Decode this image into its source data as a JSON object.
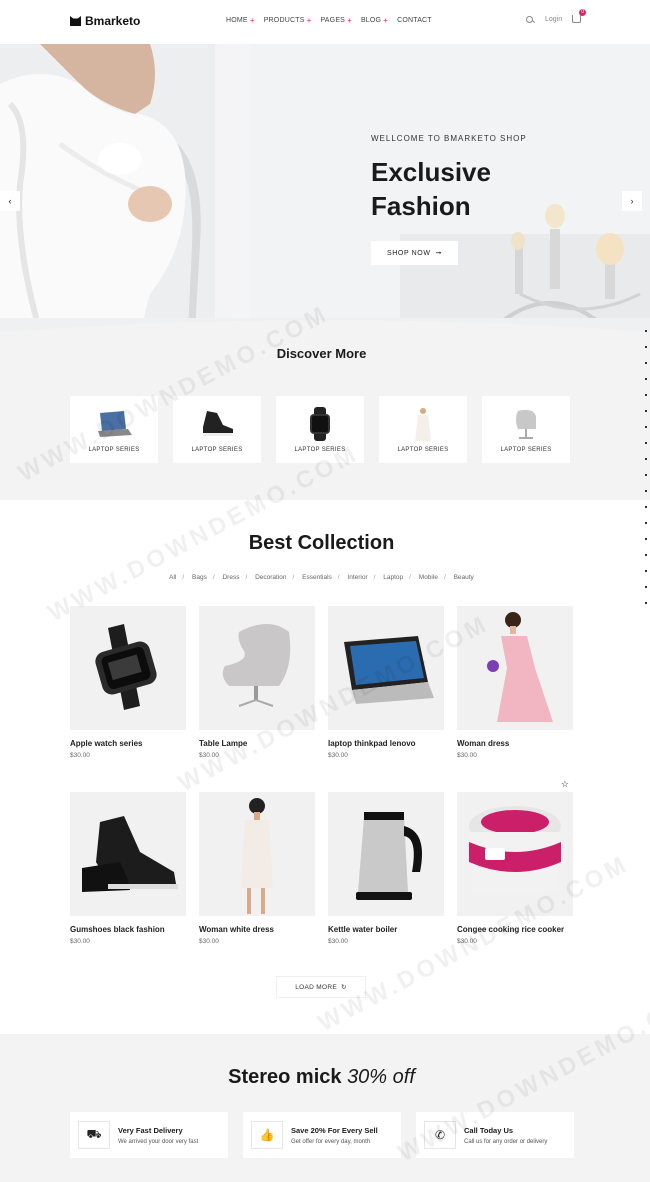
{
  "header": {
    "logo": "Bmarketo",
    "nav": [
      {
        "label": "HOME",
        "has_submenu": true
      },
      {
        "label": "PRODUCTS",
        "has_submenu": true
      },
      {
        "label": "PAGES",
        "has_submenu": true
      },
      {
        "label": "BLOG",
        "has_submenu": true
      },
      {
        "label": "CONTACT",
        "has_submenu": false
      }
    ],
    "nav_plus": "+",
    "login": "Login",
    "cart_count": "0"
  },
  "hero": {
    "kicker": "WELLCOME TO BMARKETO SHOP",
    "title_line1": "Exclusive",
    "title_line2": "Fashion",
    "button": "SHOP NOW",
    "button_arrow": "➞",
    "prev_arrow": "‹",
    "next_arrow": "›"
  },
  "discover": {
    "title": "Discover More",
    "categories": [
      {
        "label": "LAPTOP SERIES",
        "icon": "laptop-icon"
      },
      {
        "label": "LAPTOP SERIES",
        "icon": "sneaker-icon"
      },
      {
        "label": "LAPTOP SERIES",
        "icon": "watch-icon"
      },
      {
        "label": "LAPTOP SERIES",
        "icon": "dress-icon"
      },
      {
        "label": "LAPTOP SERIES",
        "icon": "chair-icon"
      }
    ]
  },
  "collection": {
    "title": "Best Collection",
    "filters": [
      "All",
      "Bags",
      "Dress",
      "Decoration",
      "Essentials",
      "Interior",
      "Laptop",
      "Mobile",
      "Beauty"
    ],
    "filter_sep": "/",
    "products": [
      {
        "name": "Apple watch series",
        "price": "$30.00"
      },
      {
        "name": "Table Lampe",
        "price": "$30.00"
      },
      {
        "name": "laptop thinkpad lenovo",
        "price": "$30.00"
      },
      {
        "name": "Woman dress",
        "price": "$30.00"
      },
      {
        "name": "Gumshoes black fashion",
        "price": "$30.00"
      },
      {
        "name": "Woman white dress",
        "price": "$30.00"
      },
      {
        "name": "Kettle water boiler",
        "price": "$30.00"
      },
      {
        "name": "Congee cooking rice cooker",
        "price": "$30.00"
      }
    ],
    "load_more": "LOAD MORE",
    "load_more_icon": "↻",
    "fav_icon": "☆"
  },
  "promo": {
    "title_main": "Stereo mick",
    "title_em": "30% off",
    "features": [
      {
        "title": "Very Fast Delivery",
        "sub": "We arrived your door very fast",
        "icon": "truck-icon",
        "glyph": "⛟"
      },
      {
        "title": "Save 20% For Every Sell",
        "sub": "Get offer for every day, month",
        "icon": "thumbs-up-icon",
        "glyph": "👍"
      },
      {
        "title": "Call Today Us",
        "sub": "Call us for any order or delivery",
        "icon": "phone-icon",
        "glyph": "✆"
      }
    ]
  },
  "watermark": "WWW.DOWNDEMO.COM",
  "colors": {
    "accent": "#e0245e"
  }
}
